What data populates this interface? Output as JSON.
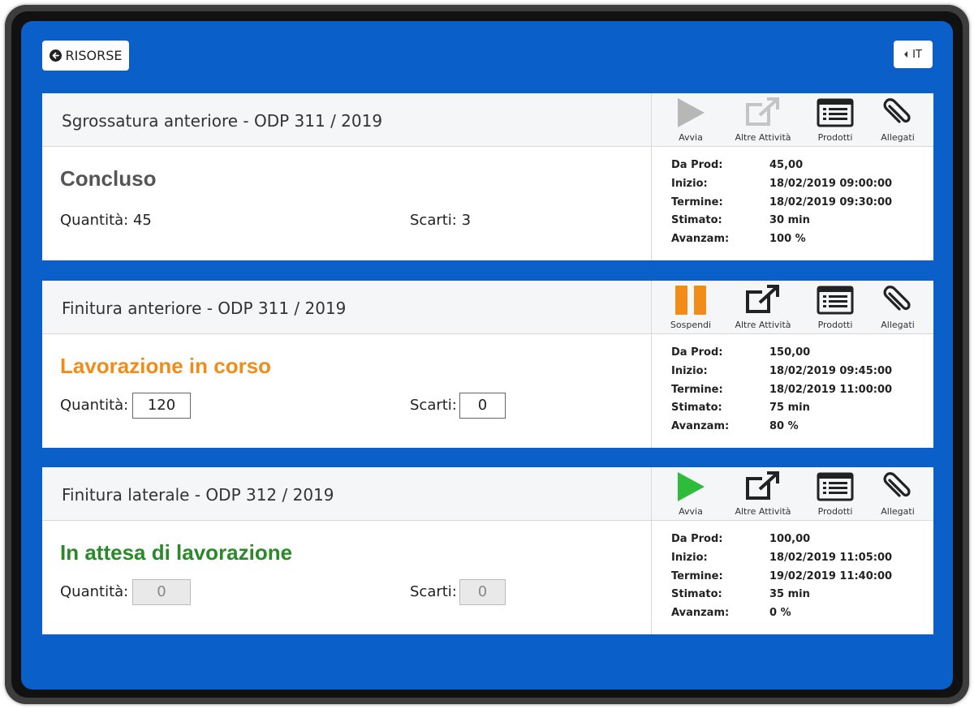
{
  "header": {
    "back_label": "RISORSE",
    "lang_label": "IT"
  },
  "colors": {
    "screen_bg": "#0a5fc8",
    "status_done": "#555555",
    "status_running": "#f28c18",
    "status_waiting": "#2a8a2a",
    "play_disabled": "#b7b7b7",
    "play_active": "#2ebd3a",
    "pause": "#f28c18"
  },
  "cards": [
    {
      "title": "Sgrossatura anteriore - ODP 311 / 2019",
      "status": "Concluso",
      "qty_label": "Quantità: 45",
      "scrap_label": "Scarti: 3",
      "actions": {
        "primary_label": "Avvia",
        "primary_icon": "play-icon",
        "other_label": "Altre Attività",
        "products_label": "Prodotti",
        "attachments_label": "Allegati"
      },
      "info": {
        "da_prod_k": "Da Prod:",
        "da_prod_v": "45,00",
        "inizio_k": "Inizio:",
        "inizio_v": "18/02/2019 09:00:00",
        "termine_k": "Termine:",
        "termine_v": "18/02/2019 09:30:00",
        "stimato_k": "Stimato:",
        "stimato_v": "30 min",
        "avanzam_k": "Avanzam:",
        "avanzam_v": "100 %"
      }
    },
    {
      "title": "Finitura anteriore - ODP 311 / 2019",
      "status": "Lavorazione in corso",
      "qty_label": "Quantità:",
      "qty_value": "120",
      "scrap_label": "Scarti:",
      "scrap_value": "0",
      "actions": {
        "primary_label": "Sospendi",
        "primary_icon": "pause-icon",
        "other_label": "Altre Attività",
        "products_label": "Prodotti",
        "attachments_label": "Allegati"
      },
      "info": {
        "da_prod_k": "Da Prod:",
        "da_prod_v": "150,00",
        "inizio_k": "Inizio:",
        "inizio_v": "18/02/2019 09:45:00",
        "termine_k": "Termine:",
        "termine_v": "18/02/2019 11:00:00",
        "stimato_k": "Stimato:",
        "stimato_v": "75 min",
        "avanzam_k": "Avanzam:",
        "avanzam_v": "80 %"
      }
    },
    {
      "title": "Finitura laterale - ODP 312 / 2019",
      "status": "In attesa di lavorazione",
      "qty_label": "Quantità:",
      "qty_value": "0",
      "scrap_label": "Scarti:",
      "scrap_value": "0",
      "actions": {
        "primary_label": "Avvia",
        "primary_icon": "play-icon",
        "other_label": "Altre Attività",
        "products_label": "Prodotti",
        "attachments_label": "Allegati"
      },
      "info": {
        "da_prod_k": "Da Prod:",
        "da_prod_v": "100,00",
        "inizio_k": "Inizio:",
        "inizio_v": "18/02/2019 11:05:00",
        "termine_k": "Termine:",
        "termine_v": "19/02/2019 11:40:00",
        "stimato_k": "Stimato:",
        "stimato_v": "35 min",
        "avanzam_k": "Avanzam:",
        "avanzam_v": "0 %"
      }
    }
  ]
}
